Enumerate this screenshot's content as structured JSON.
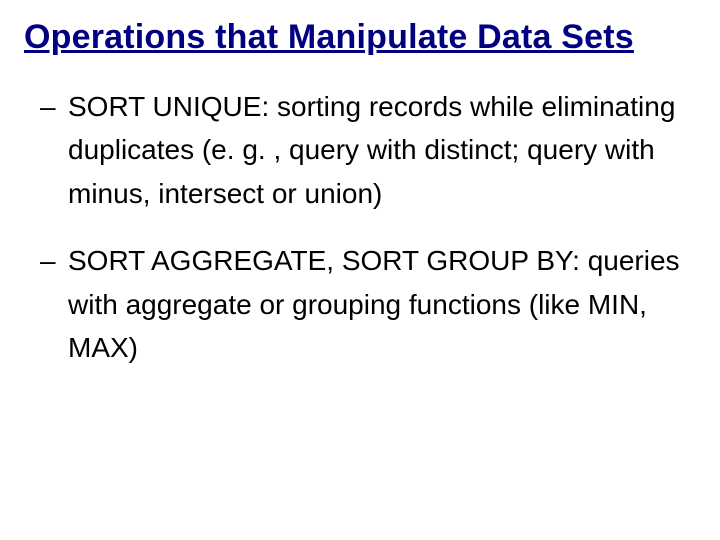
{
  "title": "Operations that Manipulate Data Sets",
  "bullets": [
    {
      "dash": "–",
      "text": "SORT UNIQUE: sorting records while eliminating duplicates (e. g. , query with distinct; query with minus, intersect or union)"
    },
    {
      "dash": "–",
      "text": "SORT AGGREGATE, SORT GROUP BY: queries with aggregate or grouping functions (like MIN, MAX)"
    }
  ]
}
